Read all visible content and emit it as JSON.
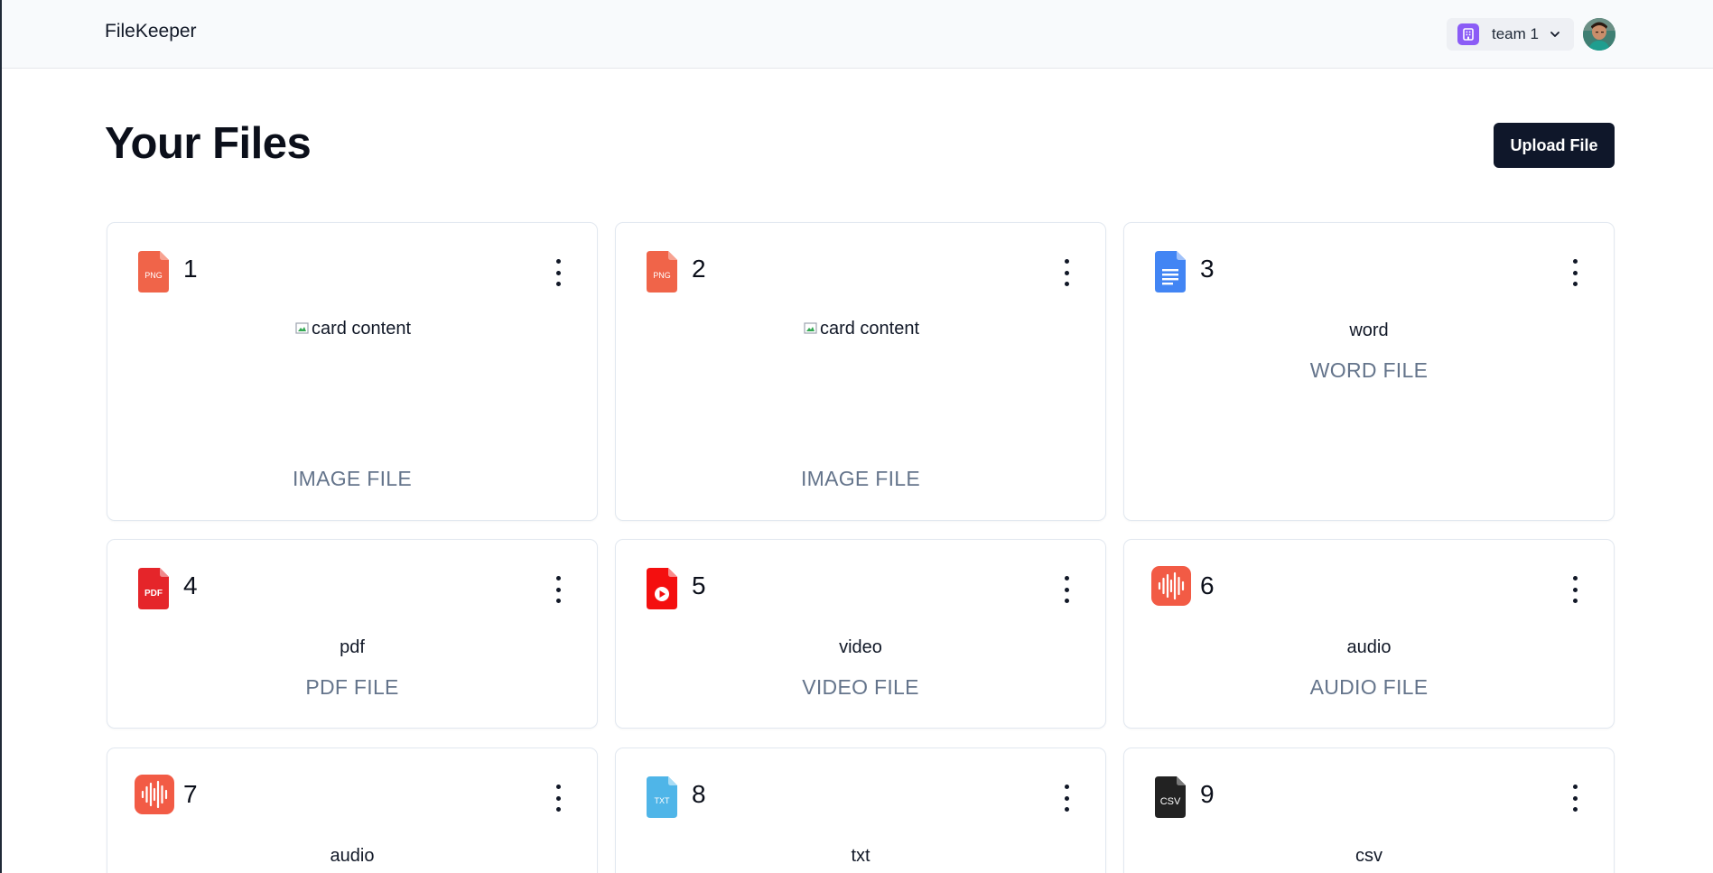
{
  "header": {
    "brand": "FileKeeper",
    "team": {
      "name": "team 1"
    }
  },
  "main": {
    "title": "Your Files",
    "upload_label": "Upload File"
  },
  "files": [
    {
      "title": "1",
      "icon": "png-file-icon",
      "preview_alt": "card content",
      "type_label": "IMAGE FILE"
    },
    {
      "title": "2",
      "icon": "png-file-icon",
      "preview_alt": "card content",
      "type_label": "IMAGE FILE"
    },
    {
      "title": "3",
      "icon": "word-doc-icon",
      "name": "word",
      "type_label": "WORD FILE"
    },
    {
      "title": "4",
      "icon": "pdf-file-icon",
      "name": "pdf",
      "type_label": "PDF FILE"
    },
    {
      "title": "5",
      "icon": "video-file-icon",
      "name": "video",
      "type_label": "VIDEO FILE"
    },
    {
      "title": "6",
      "icon": "audio-file-icon",
      "name": "audio",
      "type_label": "AUDIO FILE"
    },
    {
      "title": "7",
      "icon": "audio-file-icon",
      "name": "audio"
    },
    {
      "title": "8",
      "icon": "txt-file-icon",
      "name": "txt"
    },
    {
      "title": "9",
      "icon": "csv-file-icon",
      "name": "csv"
    }
  ],
  "colors": {
    "primary_button": "#0f172a",
    "team_badge": "#8b5cf6",
    "muted_text": "#64748b"
  }
}
